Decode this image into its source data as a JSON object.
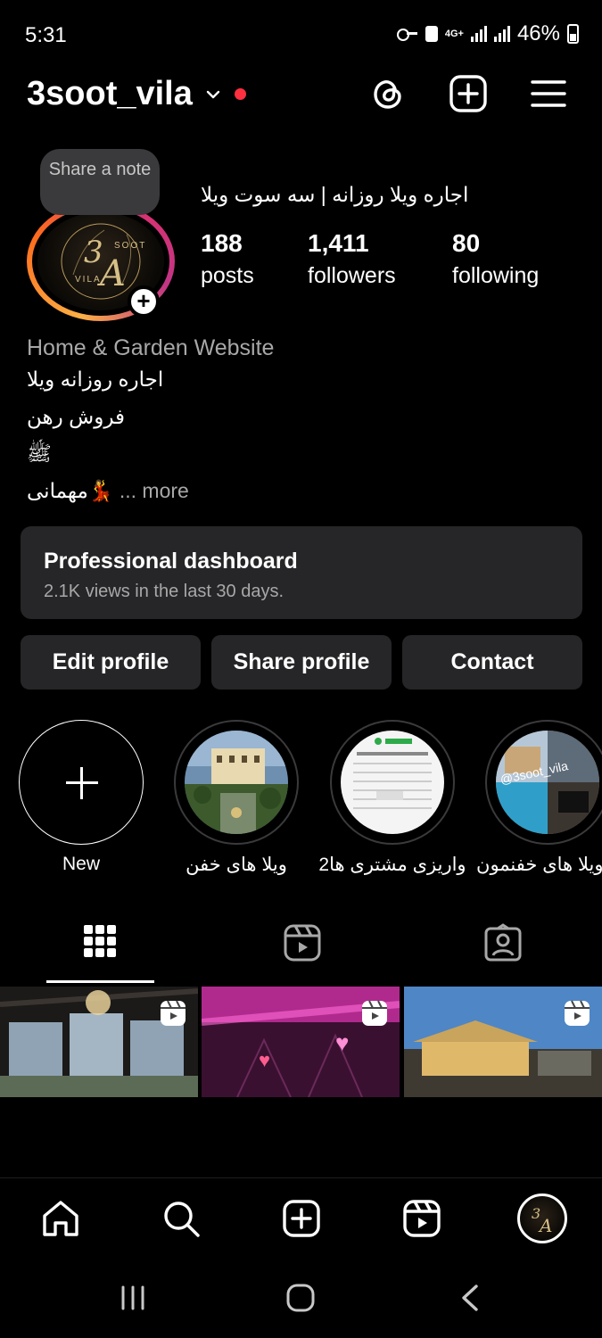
{
  "status_bar": {
    "time": "5:31",
    "network": "4G+",
    "battery": "46%"
  },
  "header": {
    "username": "3soot_vila"
  },
  "profile": {
    "note_label": "Share a note",
    "full_name": "اجاره ویلا روزانه | سه سوت ویلا",
    "stats": [
      {
        "value": "188",
        "label": "posts"
      },
      {
        "value": "1,411",
        "label": "followers"
      },
      {
        "value": "80",
        "label": "following"
      }
    ],
    "category": "Home & Garden Website",
    "bio_lines": [
      "اجاره روزانه ویلا",
      "فروش رهن",
      "ﷺ"
    ],
    "bio_last": "مهمانی💃",
    "bio_more": "... more",
    "avatar_monogram": "3A",
    "avatar_text": "SOOT VILA"
  },
  "dashboard": {
    "title": "Professional dashboard",
    "subtitle": "2.1K views in the last 30 days."
  },
  "buttons": {
    "edit": "Edit profile",
    "share": "Share profile",
    "contact": "Contact"
  },
  "highlights": [
    {
      "label": "New"
    },
    {
      "label": "ویلا های خفن"
    },
    {
      "label": "واریزی مشتری ها2"
    },
    {
      "label": "ویلا های خفنمون..."
    }
  ],
  "highlight_overlay_text": "@3soot_vila",
  "tabs": [
    "grid-icon",
    "reels-icon",
    "tagged-icon"
  ],
  "bottom_nav": [
    "home-icon",
    "search-icon",
    "create-icon",
    "reels-icon",
    "profile-avatar"
  ],
  "colors": {
    "background": "#000000",
    "surface": "#262628",
    "muted": "#a8a8a8",
    "notification": "#ff3040"
  }
}
